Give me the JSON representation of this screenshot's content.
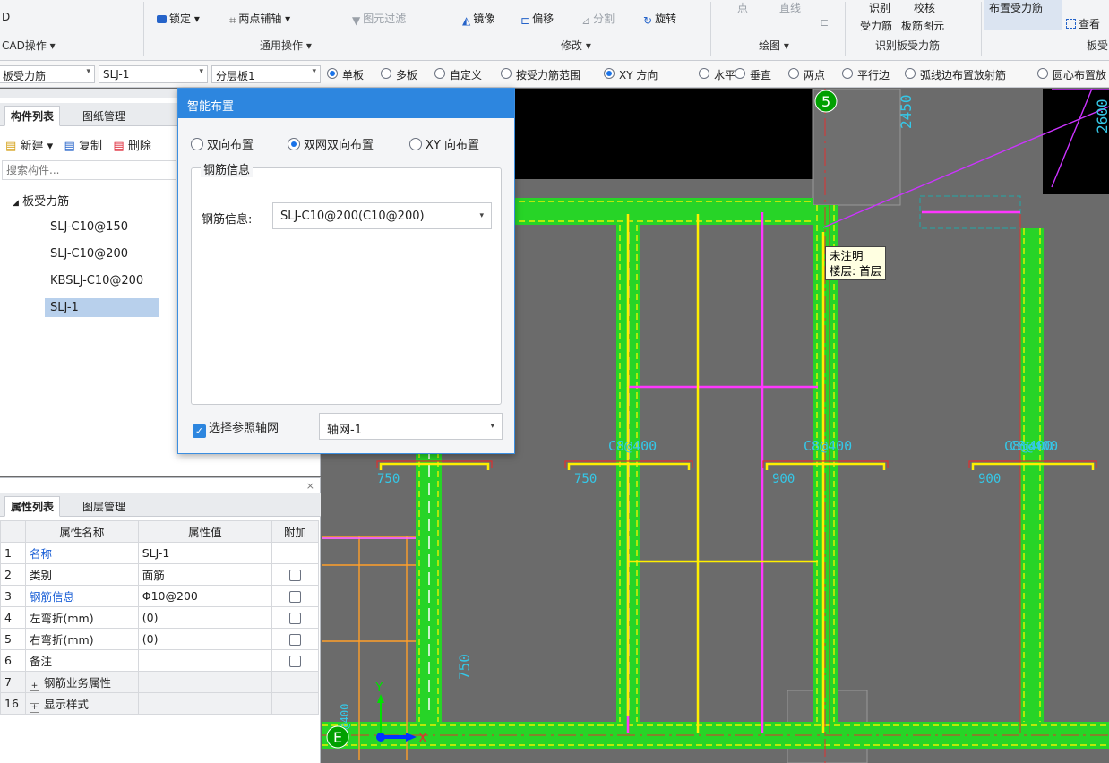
{
  "ribbon": {
    "item_d": "D",
    "cad_ops": "CAD操作 ▾",
    "lock": "锁定 ▾",
    "two_point_axis": "两点辅轴 ▾",
    "filter": "图元过滤",
    "general_ops": "通用操作 ▾",
    "mirror": "镜像",
    "offset": "偏移",
    "split": "分割",
    "rotate": "旋转",
    "modify": "修改 ▾",
    "point": "点",
    "line": "直线",
    "draw": "绘图 ▾",
    "identify_line1": "识别",
    "identify_line2": "受力筋",
    "verify_line1": "校核",
    "verify_line2": "板筋图元",
    "identify_group": "识别板受力筋",
    "place_bar": "布置受力筋",
    "view": "查看",
    "board_group": "板受"
  },
  "toolbar2": {
    "type_combo": "板受力筋",
    "name_combo": "SLJ-1",
    "layer_combo": "分层板1",
    "options": [
      {
        "label": "单板",
        "selected": true
      },
      {
        "label": "多板",
        "selected": false
      },
      {
        "label": "自定义",
        "selected": false
      },
      {
        "label": "按受力筋范围",
        "selected": false
      },
      {
        "label": "XY 方向",
        "selected": true
      },
      {
        "label": "水平",
        "selected": false
      },
      {
        "label": "垂直",
        "selected": false
      },
      {
        "label": "两点",
        "selected": false
      },
      {
        "label": "平行边",
        "selected": false
      },
      {
        "label": "弧线边布置放射筋",
        "selected": false
      },
      {
        "label": "圆心布置放",
        "selected": false
      }
    ]
  },
  "component_panel": {
    "tab_components": "构件列表",
    "tab_drawings": "图纸管理",
    "new_btn": "新建 ▾",
    "copy_btn": "复制",
    "delete_btn": "删除",
    "search_placeholder": "搜索构件...",
    "tree_root": "板受力筋",
    "items": [
      "SLJ-C10@150",
      "SLJ-C10@200",
      "KBSLJ-C10@200",
      "SLJ-1"
    ],
    "selected_index": 3
  },
  "property_panel": {
    "tab_props": "属性列表",
    "tab_layers": "图层管理",
    "col_name": "属性名称",
    "col_value": "属性值",
    "col_extra": "附加",
    "rows": [
      {
        "num": "1",
        "name": "名称",
        "value": "SLJ-1",
        "blue": true,
        "checkbox": false
      },
      {
        "num": "2",
        "name": "类别",
        "value": "面筋",
        "blue": false,
        "checkbox": true
      },
      {
        "num": "3",
        "name": "钢筋信息",
        "value": "Φ10@200",
        "blue": true,
        "checkbox": true
      },
      {
        "num": "4",
        "name": "左弯折(mm)",
        "value": "(0)",
        "blue": false,
        "checkbox": true
      },
      {
        "num": "5",
        "name": "右弯折(mm)",
        "value": "(0)",
        "blue": false,
        "checkbox": true
      },
      {
        "num": "6",
        "name": "备注",
        "value": "",
        "blue": false,
        "checkbox": true
      },
      {
        "num": "7",
        "name": "钢筋业务属性",
        "value": "",
        "blue": false,
        "checkbox": false,
        "expand": true
      },
      {
        "num": "16",
        "name": "显示样式",
        "value": "",
        "blue": false,
        "checkbox": false,
        "expand": true
      }
    ]
  },
  "dialog": {
    "title": "智能布置",
    "radio_bidirectional": "双向布置",
    "radio_double_net": "双网双向布置",
    "radio_xy": "XY 向布置",
    "selected_radio": "双网双向布置",
    "group_label": "钢筋信息",
    "rebar_label": "钢筋信息:",
    "rebar_value": "SLJ-C10@200(C10@200)",
    "ref_axis_label": "选择参照轴网",
    "ref_axis_checked": true,
    "axis_value": "轴网-1"
  },
  "canvas": {
    "axis_label_5": "5",
    "axis_label_e": "E",
    "dim_2450": "2450",
    "dim_2600": "2600",
    "rebar_labels": [
      "C8@400",
      "C8@400",
      "C8@400",
      "C8@400"
    ],
    "dims_750": "750",
    "dims_900": "900",
    "tooltip_line1": "未注明",
    "tooltip_line2": "楼层: 首层",
    "y_axis": "Y",
    "x_axis": "X"
  }
}
